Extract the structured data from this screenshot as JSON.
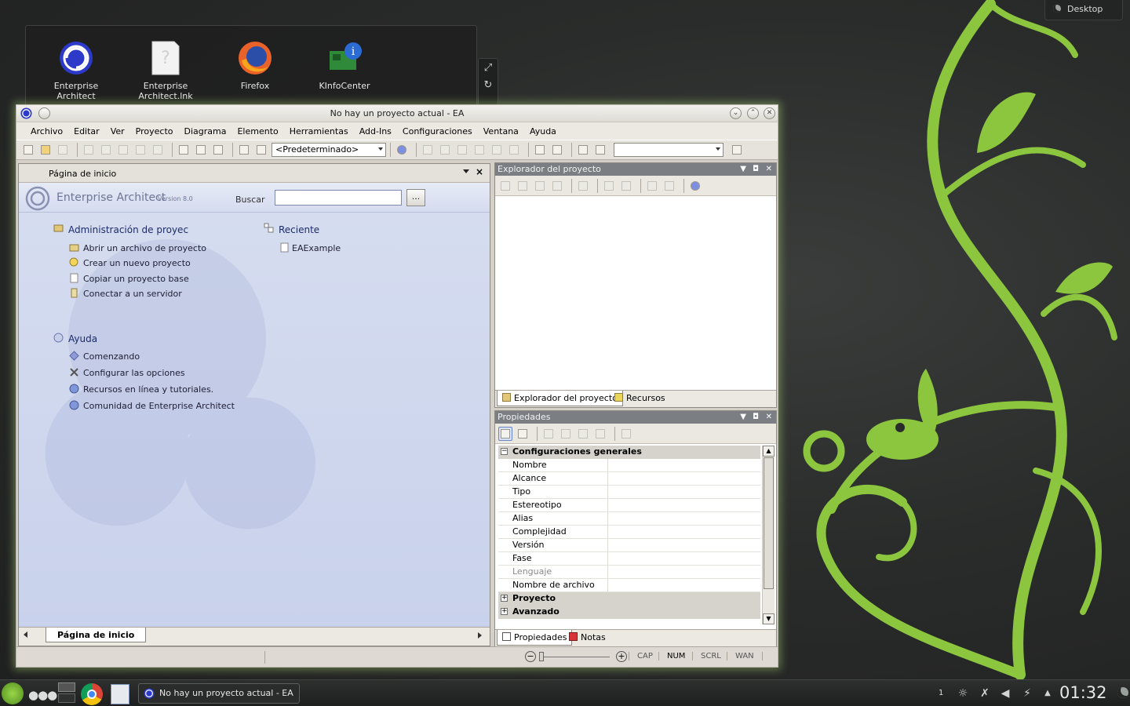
{
  "desktop": {
    "toolbox_label": "Desktop",
    "icons": [
      {
        "label": "Enterprise Architect",
        "icon": "ea-logo-icon"
      },
      {
        "label": "Enterprise Architect.lnk",
        "icon": "unknown-file-icon"
      },
      {
        "label": "Firefox",
        "icon": "firefox-icon"
      },
      {
        "label": "KInfoCenter",
        "icon": "kinfocenter-icon"
      }
    ]
  },
  "window": {
    "title": "No hay un proyecto actual - EA",
    "menu": [
      "Archivo",
      "Editar",
      "Ver",
      "Proyecto",
      "Diagrama",
      "Elemento",
      "Herramientas",
      "Add-Ins",
      "Configuraciones",
      "Ventana",
      "Ayuda"
    ],
    "toolbar_combo": "<Predeterminado>"
  },
  "startpage": {
    "panel_title": "Página de inicio",
    "brand": "Enterprise Architect",
    "version": "Version 8.0",
    "search_label": "Buscar",
    "search_button": "...",
    "admin_heading": "Administración de proyec",
    "admin_links": [
      "Abrir un archivo de proyecto",
      "Crear un nuevo proyecto",
      "Copiar un proyecto base",
      "Conectar a un servidor"
    ],
    "recent_heading": "Reciente",
    "recent_items": [
      "EAExample"
    ],
    "help_heading": "Ayuda",
    "help_links": [
      "Comenzando",
      "Configurar las opciones",
      "Recursos en línea y tutoriales.",
      "Comunidad de Enterprise Architect"
    ],
    "tab_label": "Página de inicio"
  },
  "explorer": {
    "title": "Explorador del proyecto",
    "tabs": [
      "Explorador del proyecto",
      "Recursos"
    ]
  },
  "properties": {
    "title": "Propiedades",
    "group_general": "Configuraciones generales",
    "fields": [
      "Nombre",
      "Alcance",
      "Tipo",
      "Estereotipo",
      "Alias",
      "Complejidad",
      "Versión",
      "Fase",
      "Lenguaje",
      "Nombre de archivo"
    ],
    "group_project": "Proyecto",
    "group_advanced": "Avanzado",
    "tabs": [
      "Propiedades",
      "Notas"
    ]
  },
  "statusbar": {
    "indicators": [
      "CAP",
      "NUM",
      "SCRL",
      "WAN"
    ]
  },
  "taskbar": {
    "task_title": "No hay un proyecto actual - EA",
    "pager": "1",
    "clock": "01:32"
  },
  "colors": {
    "accent_green": "#8cc63f",
    "window_bg": "#d4d0c8",
    "startpage_bg": "#c9d2ec"
  }
}
